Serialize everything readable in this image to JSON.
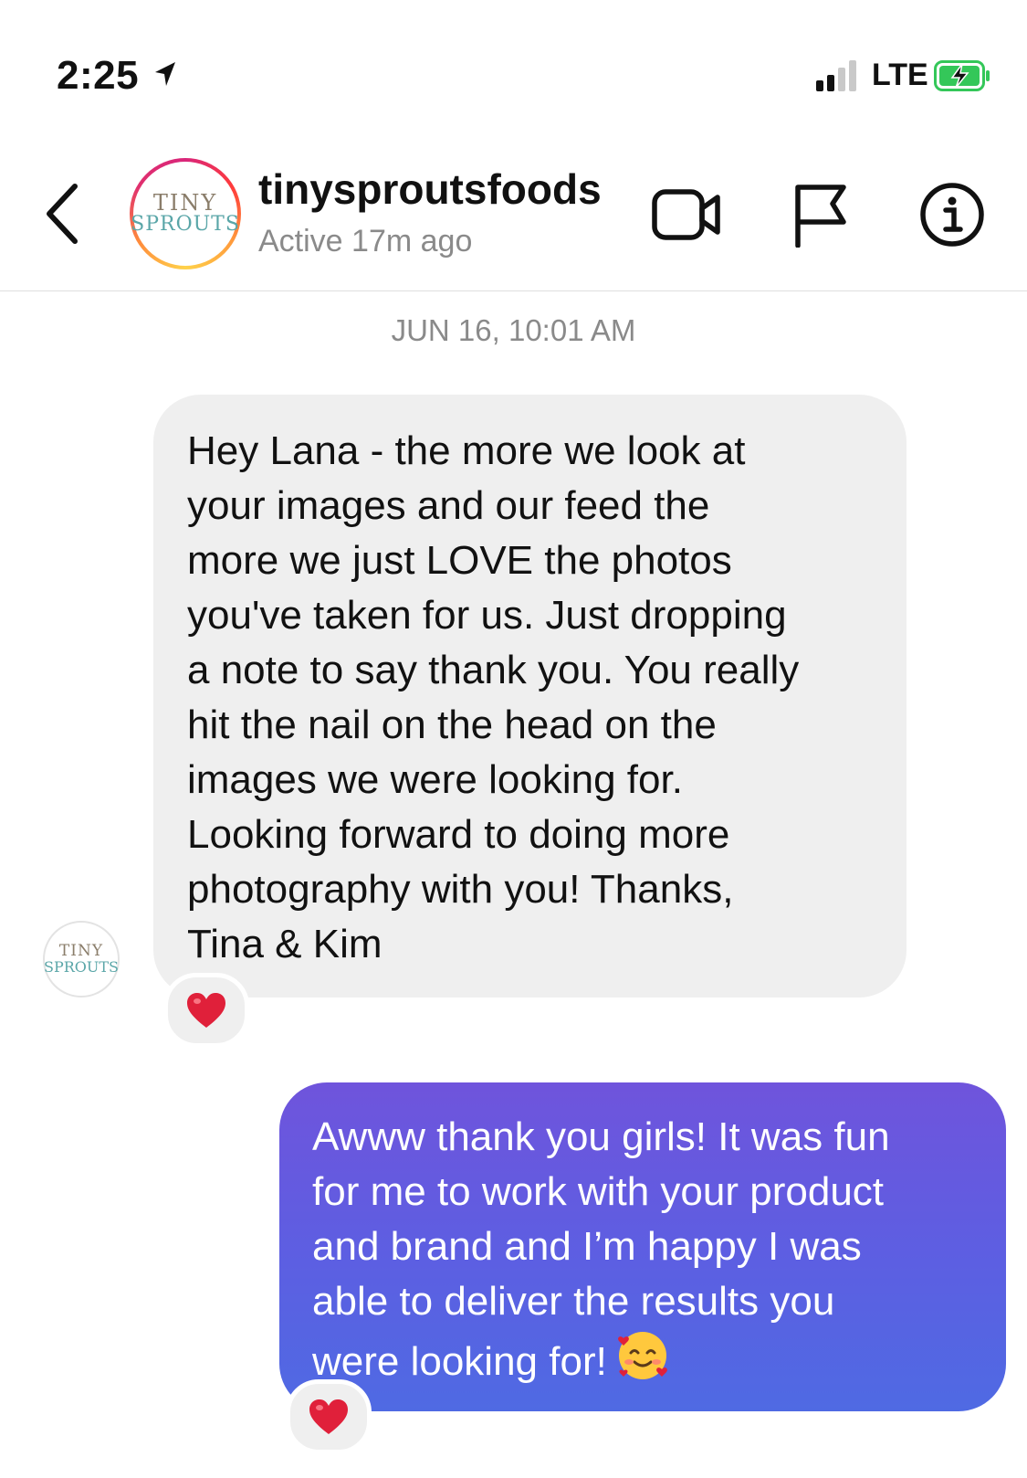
{
  "status_bar": {
    "time": "2:25",
    "network": "LTE",
    "signal_bars_filled": 2,
    "signal_bars_total": 4,
    "battery_state": "charging"
  },
  "header": {
    "avatar_logo_line1": "TINY",
    "avatar_logo_line2": "SPROUTS",
    "username": "tinysproutsfoods",
    "status": "Active 17m ago",
    "icons": [
      "back-chevron-icon",
      "video-camera-icon",
      "flag-icon",
      "info-icon"
    ]
  },
  "conversation": {
    "timestamp": "JUN 16, 10:01 AM",
    "messages": [
      {
        "direction": "incoming",
        "text": "Hey Lana - the more we look at\nyour images and our feed the\nmore we just LOVE the photos\nyou've taken for us. Just dropping\na note to say thank you. You really\nhit the nail on the head on the\nimages we were looking for.\nLooking forward to doing more\nphotography with you! Thanks,\nTina & Kim",
        "reaction": "❤️"
      },
      {
        "direction": "outgoing",
        "text": "Awww thank you girls! It was fun\nfor me to work with your product\nand brand and I’m happy I was\nable to deliver the results you\nwere looking for!",
        "emoji": "smiling-face-with-hearts",
        "reaction": "❤️"
      }
    ]
  },
  "colors": {
    "incoming_bubble": "#efefef",
    "outgoing_gradient_top": "#6f54dc",
    "outgoing_gradient_bottom": "#4f6ae3",
    "heart": "#e0203a",
    "charging_green": "#34c759"
  }
}
